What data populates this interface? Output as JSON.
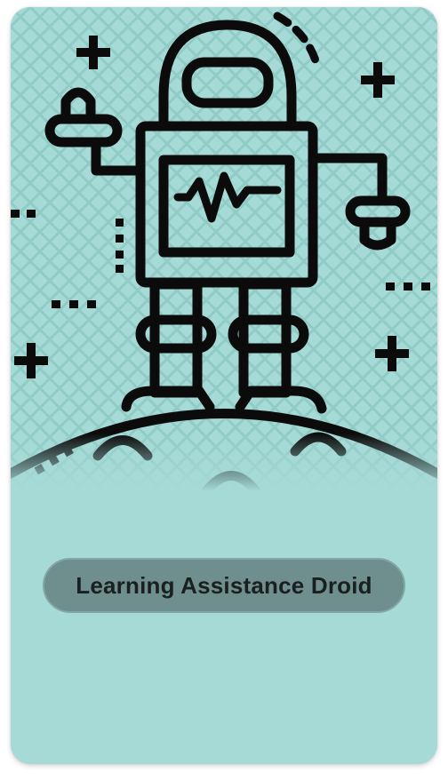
{
  "card": {
    "title": "Learning Assistance Droid",
    "illustration_icon": "astronaut-droid-icon",
    "colors": {
      "card_background": "#a6dad6",
      "line_art": "#0b0b0b",
      "pill_background": "#6e8f8d",
      "pill_text": "#1a1f1f"
    }
  }
}
